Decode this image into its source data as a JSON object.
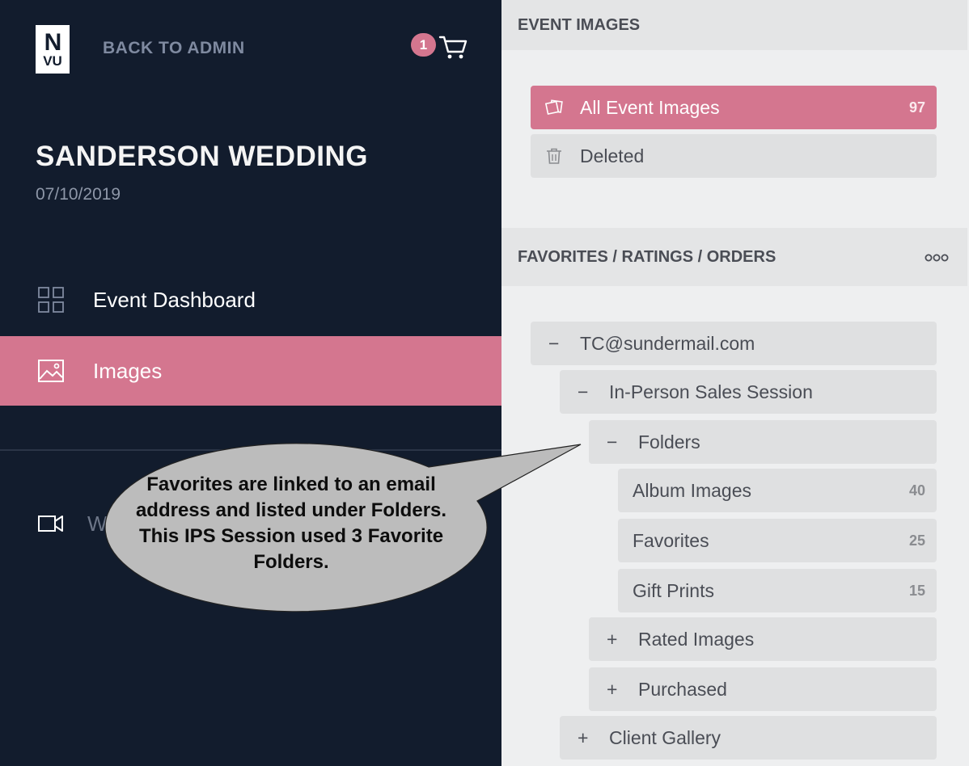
{
  "sidebar": {
    "logo_top": "N",
    "logo_bottom": "VU",
    "back_label": "BACK TO ADMIN",
    "cart_count": "1",
    "event_title": "SANDERSON WEDDING",
    "event_date": "07/10/2019",
    "nav": [
      {
        "label": "Event Dashboard",
        "icon": "grid-icon"
      },
      {
        "label": "Images",
        "icon": "image-icon",
        "active": true
      },
      {
        "label": "W",
        "icon": "video-icon"
      }
    ]
  },
  "panel": {
    "event_images_header": "EVENT IMAGES",
    "all_images": {
      "label": "All Event Images",
      "count": "97"
    },
    "deleted": {
      "label": "Deleted"
    },
    "favorites_header": "FAVORITES / RATINGS / ORDERS",
    "tree": [
      {
        "label": "TC@sundermail.com",
        "toggle": "−"
      },
      {
        "label": "In-Person Sales Session",
        "toggle": "−"
      },
      {
        "label": "Folders",
        "toggle": "−"
      },
      {
        "label": "Album Images",
        "count": "40"
      },
      {
        "label": "Favorites",
        "count": "25"
      },
      {
        "label": "Gift Prints",
        "count": "15"
      },
      {
        "label": "Rated Images",
        "toggle": "+"
      },
      {
        "label": "Purchased",
        "toggle": "+"
      },
      {
        "label": "Client Gallery",
        "toggle": "+"
      }
    ]
  },
  "callout": {
    "text": "Favorites are linked to an email address and listed under Folders. This IPS Session used 3 Favorite Folders."
  },
  "colors": {
    "sidebar_bg": "#121c2d",
    "accent_pink": "#d4768f",
    "panel_bg": "#eeeff0",
    "row_bg": "#dfe0e1"
  }
}
